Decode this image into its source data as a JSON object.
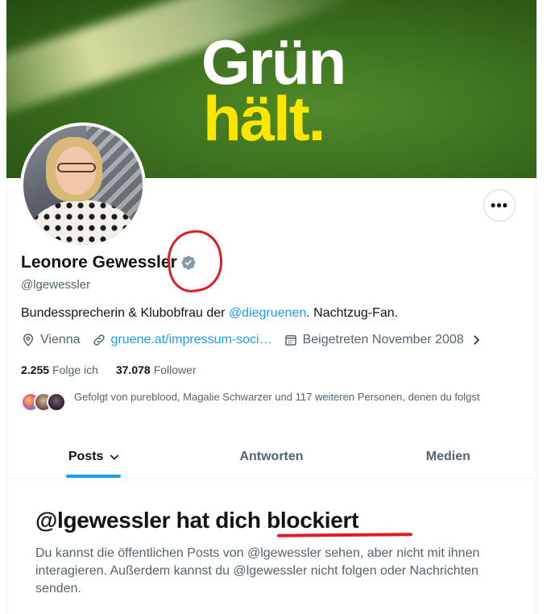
{
  "banner": {
    "line1": "Grün",
    "line2": "hält."
  },
  "profile": {
    "display_name": "Leonore Gewessler",
    "handle": "@lgewessler",
    "bio_before": "Bundessprecherin & Klubobfrau der ",
    "bio_mention": "@diegruenen",
    "bio_after": ". Nachtzug-Fan.",
    "location": "Vienna",
    "link": "gruene.at/impressum-soci…",
    "joined": "Beigetreten November 2008",
    "following_count": "2.255",
    "following_label": "Folge ich",
    "followers_count": "37.078",
    "followers_label": "Follower",
    "followed_by": "Gefolgt von pureblood, Magalie Schwarzer und 117 weiteren Personen, denen du folgst"
  },
  "actions": {
    "more": "•••"
  },
  "tabs": [
    {
      "label": "Posts"
    },
    {
      "label": "Antworten"
    },
    {
      "label": "Medien"
    }
  ],
  "blocked": {
    "title_prefix": "@lgewessler hat dich ",
    "title_emph": "blockiert",
    "text": "Du kannst die öffentlichen Posts von @lgewessler sehen, aber nicht mit ihnen interagieren. Außerdem kannst du @lgewessler nicht folgen oder Nachrichten senden."
  },
  "colors": {
    "accent": "#1d9bf0",
    "annotation": "#e01b24",
    "banner_green": "#3e7420",
    "banner_yellow": "#ffe600"
  }
}
